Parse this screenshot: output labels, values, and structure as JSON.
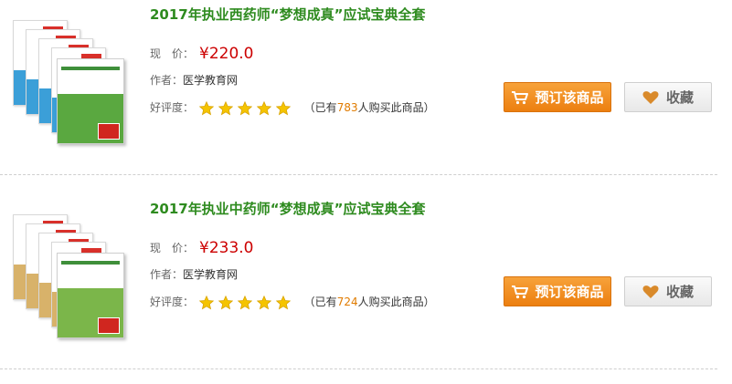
{
  "labels": {
    "price": "现　价：",
    "author": "作者：",
    "rating": "好评度：",
    "buyers_prefix": "（已有",
    "buyers_suffix": "人购买此商品）",
    "order_button": "预订该商品",
    "favorite_button": "收藏"
  },
  "colors": {
    "title": "#2e8b1f",
    "price": "#cc0000",
    "buyer_count": "#e07b00",
    "order_button": "#f0901f",
    "star": "#f5c400"
  },
  "icons": {
    "order_button": "cart-icon",
    "favorite_button": "heart-icon",
    "rating": "star-icon"
  },
  "products": [
    {
      "title": "2017年执业西药师“梦想成真”应试宝典全套",
      "price": "¥220.0",
      "author": "医学教育网",
      "rating_stars": 5,
      "rating_max": 5,
      "buyers": "783"
    },
    {
      "title": "2017年执业中药师“梦想成真”应试宝典全套",
      "price": "¥233.0",
      "author": "医学教育网",
      "rating_stars": 5,
      "rating_max": 5,
      "buyers": "724"
    }
  ]
}
